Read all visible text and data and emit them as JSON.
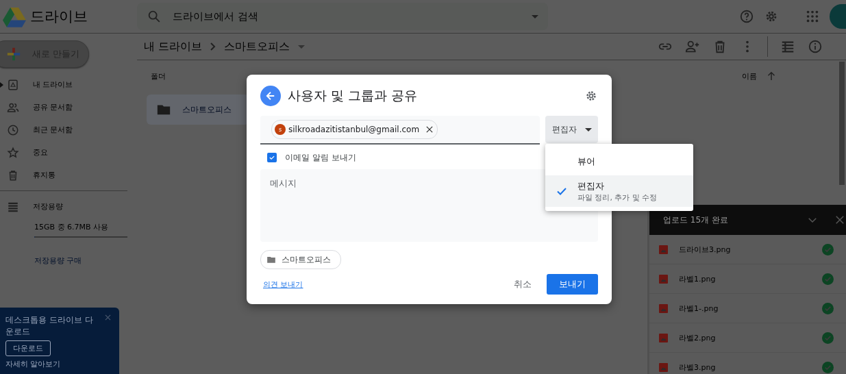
{
  "app": {
    "title": "드라이브"
  },
  "search": {
    "placeholder": "드라이브에서 검색"
  },
  "new_button": {
    "label": "새로 만들기"
  },
  "sidebar": {
    "items": [
      {
        "label": "내 드라이브",
        "expanded": false
      },
      {
        "label": "공유 문서함"
      },
      {
        "label": "최근 문서함"
      },
      {
        "label": "중요"
      },
      {
        "label": "휴지통"
      }
    ],
    "storage": {
      "label": "저장용량",
      "usage": "15GB 중 6.7MB 사용",
      "level": 0.01,
      "buy_link": "저장용량 구매"
    }
  },
  "breadcrumb": [
    {
      "label": "내 드라이브"
    },
    {
      "label": "스마트오피스"
    }
  ],
  "file_list": {
    "section_title": "폴더",
    "sort_label": "이름",
    "folders": [
      {
        "name": "스마트오피스",
        "selected": true
      }
    ]
  },
  "banner": {
    "title": "데스크톱용 드라이브 다운로드",
    "button": "다운로드",
    "link": "자세히 알아보기"
  },
  "uploads": {
    "title": "업로드 15개 완료",
    "files": [
      {
        "name": "드라이브3.png",
        "done": true
      },
      {
        "name": "라벨1.png",
        "done": true
      },
      {
        "name": "라벨1-.png",
        "done": true
      },
      {
        "name": "라벨2.png",
        "done": true
      },
      {
        "name": "라벨3.png",
        "done": true
      }
    ]
  },
  "share_dialog": {
    "title": "사용자 및 그룹과 공유",
    "recipients": [
      {
        "email": "silkroadazitistanbul@gmail.com",
        "initial": "s"
      }
    ],
    "role": "편집자",
    "notify": {
      "label": "이메일 알림 보내기",
      "checked": true
    },
    "message": {
      "placeholder": "메시지"
    },
    "item_chip": "스마트오피스",
    "feedback_link": "의견 보내기",
    "cancel": "취소",
    "send": "보내기"
  },
  "role_menu": {
    "options": [
      {
        "label": "뷰어",
        "selected": false
      },
      {
        "label": "편집자",
        "description": "파일 정리, 추가 및 수정",
        "selected": true
      }
    ]
  }
}
